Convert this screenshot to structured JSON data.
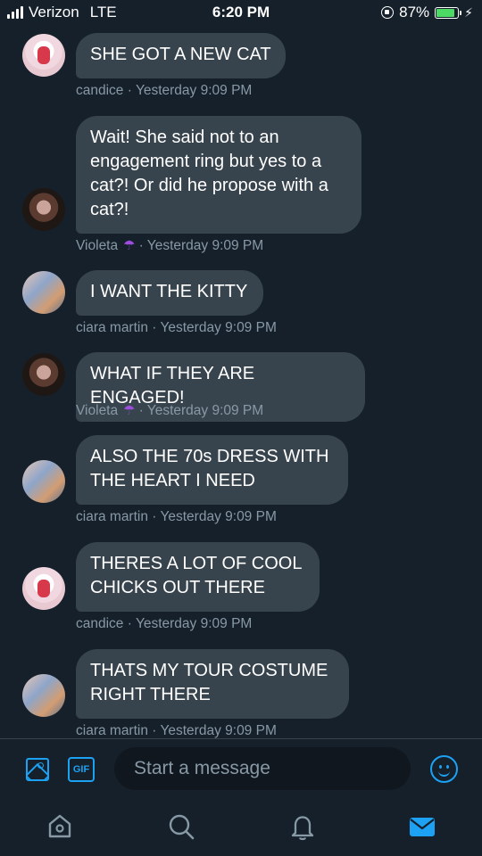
{
  "status_bar": {
    "carrier": "Verizon",
    "network": "LTE",
    "time": "6:20 PM",
    "battery": "87%",
    "battery_level": 0.87
  },
  "messages": [
    {
      "text": "SHE GOT A NEW CAT",
      "sender": "candice",
      "sender_emoji": "",
      "timestamp": "Yesterday 9:09 PM",
      "avatar": "candice"
    },
    {
      "text": "Wait! She said not to an engagement ring but yes to a cat?! Or did he propose with a cat?!",
      "sender": "Violeta",
      "sender_emoji": "☂",
      "timestamp": "Yesterday 9:09 PM",
      "avatar": "violeta"
    },
    {
      "text": "I WANT THE KITTY",
      "sender": "ciara martin",
      "sender_emoji": "",
      "timestamp": "Yesterday 9:09 PM",
      "avatar": "ciara"
    },
    {
      "text": "WHAT IF THEY ARE ENGAGED!",
      "sender": "Violeta",
      "sender_emoji": "☂",
      "timestamp": "Yesterday 9:09 PM",
      "avatar": "violeta"
    },
    {
      "text": "ALSO THE 70s DRESS WITH THE HEART I NEED",
      "sender": "ciara martin",
      "sender_emoji": "",
      "timestamp": "Yesterday 9:09 PM",
      "avatar": "ciara"
    },
    {
      "text": "THERES A LOT OF COOL CHICKS OUT THERE",
      "sender": "candice",
      "sender_emoji": "",
      "timestamp": "Yesterday 9:09 PM",
      "avatar": "candice"
    },
    {
      "text": "THATS MY TOUR COSTUME RIGHT THERE",
      "sender": "ciara martin",
      "sender_emoji": "",
      "timestamp": "Yesterday 9:09 PM",
      "avatar": "ciara"
    }
  ],
  "composer": {
    "placeholder": "Start a message",
    "gif_label": "GIF",
    "icons": [
      "image-icon",
      "gif-icon",
      "emoji-icon"
    ]
  },
  "tabs": [
    {
      "name": "home",
      "icon": "home-icon",
      "active": false
    },
    {
      "name": "search",
      "icon": "search-icon",
      "active": false
    },
    {
      "name": "notifications",
      "icon": "bell-icon",
      "active": false
    },
    {
      "name": "messages",
      "icon": "mail-icon",
      "active": true
    }
  ],
  "colors": {
    "background": "#15202b",
    "bubble": "#38444d",
    "accent": "#1da1f2",
    "muted": "#8899a6"
  }
}
